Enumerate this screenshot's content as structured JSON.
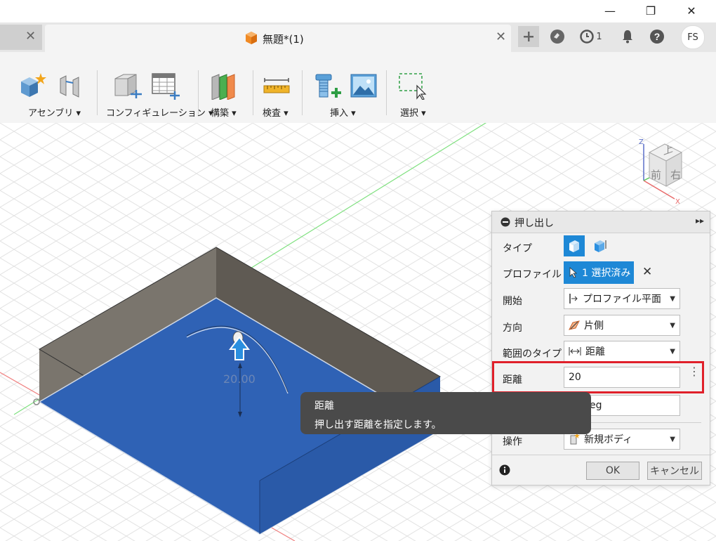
{
  "window": {
    "minimize": "—",
    "restore": "❐",
    "close": "✕"
  },
  "tabs": {
    "active_title": "無題*(1)",
    "jobs_count": "1",
    "user_initials": "FS"
  },
  "toolbar": {
    "groups": [
      {
        "label": "アセンブリ ▾"
      },
      {
        "label": "コンフィギュレーション ▾"
      },
      {
        "label": "構築 ▾"
      },
      {
        "label": "検査 ▾"
      },
      {
        "label": "挿入 ▾"
      },
      {
        "label": "選択 ▾"
      }
    ]
  },
  "viewcube": {
    "top": "上",
    "front": "前",
    "right": "右",
    "axis_z": "Z",
    "axis_x": "X"
  },
  "viewport": {
    "dimension_value": "20.00"
  },
  "dialog": {
    "title": "押し出し",
    "type_label": "タイプ",
    "profile_label": "プロファイル",
    "profile_value": "1 選択済み",
    "start_label": "開始",
    "start_value": "プロファイル平面",
    "direction_label": "方向",
    "direction_value": "片側",
    "extent_type_label": "範囲のタイプ",
    "extent_type_value": "距離",
    "distance_label": "距離",
    "distance_value": "20",
    "taper_partial": "eg",
    "operation_label": "操作",
    "operation_value": "新規ボディ",
    "ok": "OK",
    "cancel": "キャンセル"
  },
  "tooltip": {
    "title": "距離",
    "body": "押し出す距離を指定します。"
  },
  "colors": {
    "highlight": "#e0202a",
    "accent_blue": "#1e88d6",
    "body_blue": "#2f62b5",
    "body_gray": "#6f6a62"
  }
}
